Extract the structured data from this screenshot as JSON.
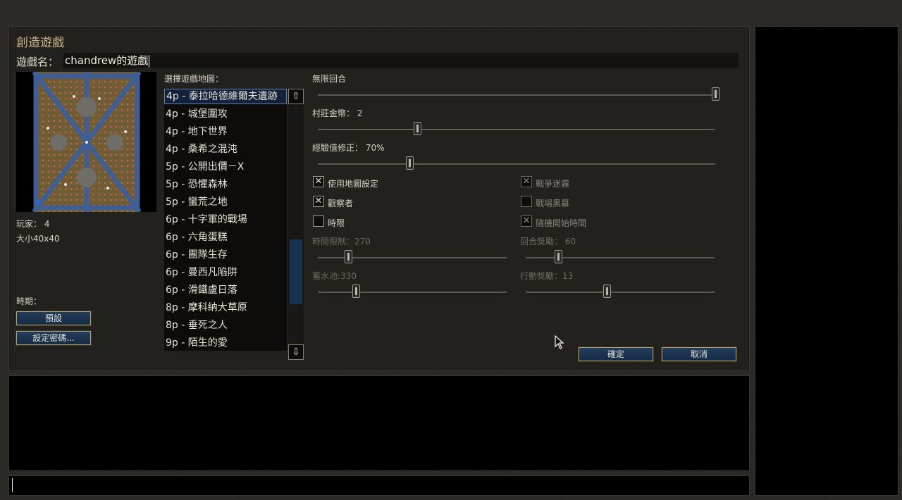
{
  "dialog": {
    "title": "創造遊戲",
    "game_name_label": "遊戲名：",
    "game_name_value": "chandrew的遊戲"
  },
  "map_info": {
    "players": "玩家： 4",
    "size": "大小40x40",
    "era_label": "時期：",
    "preset_button": "預設",
    "password_button": "設定密碼..."
  },
  "map_list": {
    "label": "選擇遊戲地圖：",
    "selected_index": 0,
    "items": [
      "4p - 泰拉哈德維爾夫遺跡",
      "4p - 城堡圍攻",
      "4p - 地下世界",
      "4p - 桑希之混沌",
      "5p - 公開出價－X",
      "5p - 恐懼森林",
      "5p - 蠻荒之地",
      "6p - 十字軍的戰場",
      "6p - 六角蛋糕",
      "6p - 團隊生存",
      "6p - 曼西凡陷阱",
      "6p - 滑鐵盧日落",
      "8p - 摩科納大草原",
      "8p - 垂死之人",
      "9p - 陌生的愛"
    ],
    "scroll_up_icon": "arrow-up-icon",
    "scroll_down_icon": "arrow-down-icon"
  },
  "settings": {
    "turns_label": "無限回合",
    "turns_level": 1.0,
    "village_gold_label": "村莊金幣： 2",
    "village_gold_level": 0.25,
    "xp_modifier_label": "經驗值修正： 70%",
    "xp_modifier_level": 0.23,
    "use_map_settings": {
      "label": "使用地圖設定",
      "checked": true
    },
    "observers": {
      "label": "觀察者",
      "checked": true
    },
    "time_limit": {
      "label": "時限",
      "checked": false
    },
    "fog_of_war": {
      "label": "戰爭迷霧",
      "checked": true
    },
    "shroud": {
      "label": "戰場黑幕",
      "checked": false
    },
    "random_start_time": {
      "label": "隨機開始時間",
      "checked": true
    },
    "time_limit_value_label": "時間限制：270",
    "time_limit_level": 0.16,
    "turn_bonus_label": "回合獎勵： 60",
    "turn_bonus_level": 0.17,
    "reservoir_label": "蓄水池:330",
    "reservoir_level": 0.2,
    "action_bonus_label": "行動獎勵：13",
    "action_bonus_level": 0.43
  },
  "buttons": {
    "ok": "確定",
    "cancel": "取消"
  }
}
